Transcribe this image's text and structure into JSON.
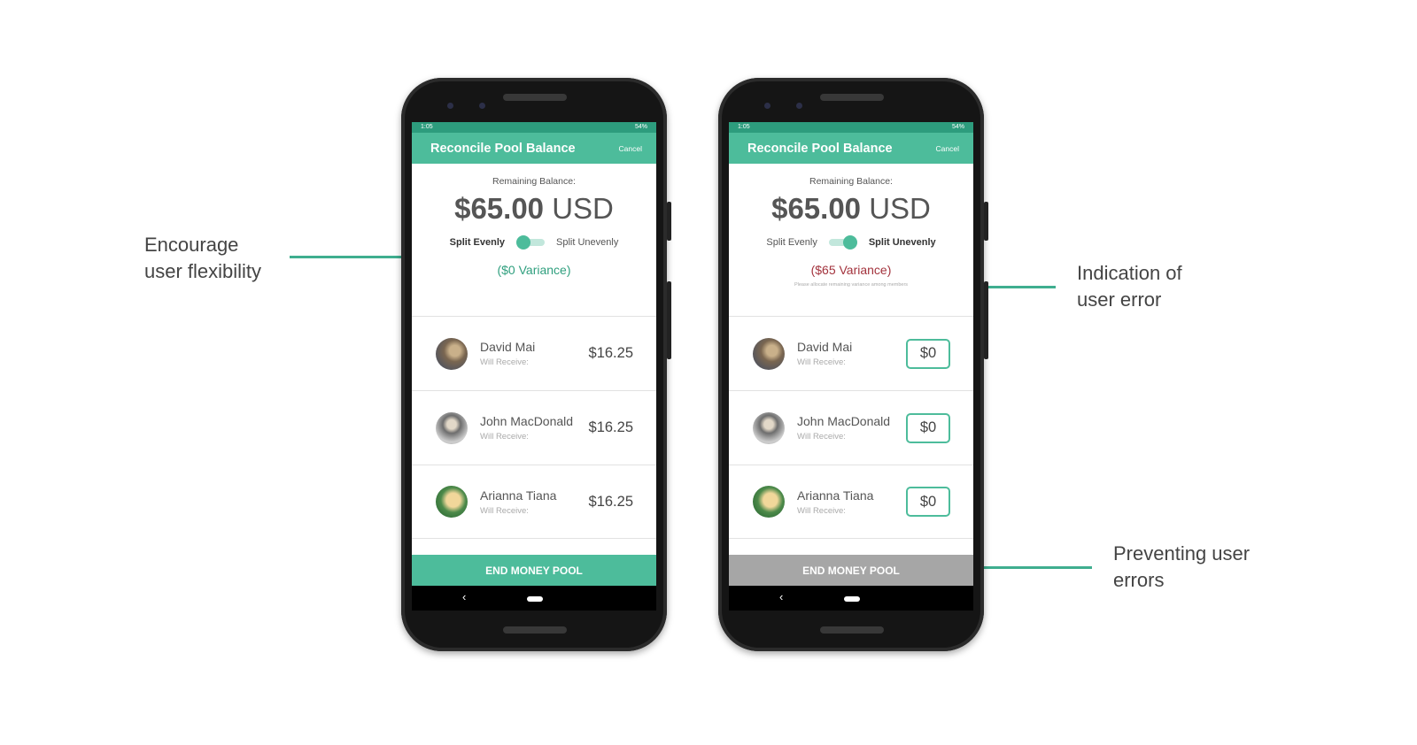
{
  "annotations": {
    "left": [
      "Encourage",
      "user flexibility"
    ],
    "right_top": [
      "Indication of",
      "user error"
    ],
    "right_bottom": [
      "Preventing user",
      "errors"
    ]
  },
  "colors": {
    "accent": "#4dbc9b",
    "status_bar": "#2d9c7d",
    "variance_ok": "#2f9f7e",
    "variance_error": "#a3333d",
    "disabled": "#a6a6a6"
  },
  "screens": [
    {
      "status": {
        "time": "1:05",
        "battery": "54%"
      },
      "appbar": {
        "title": "Reconcile Pool Balance",
        "cancel": "Cancel"
      },
      "balance": {
        "label": "Remaining Balance:",
        "amount": "$65.00",
        "currency": "USD"
      },
      "split": {
        "left": "Split Evenly",
        "right": "Split Unevenly",
        "selected": "Split Evenly"
      },
      "variance": "($0 Variance)",
      "members": [
        {
          "name": "David Mai",
          "sub": "Will Receive:",
          "amount": "$16.25"
        },
        {
          "name": "John MacDonald",
          "sub": "Will Receive:",
          "amount": "$16.25"
        },
        {
          "name": "Arianna Tiana",
          "sub": "Will Receive:",
          "amount": "$16.25"
        }
      ],
      "end_button": "END MONEY POOL",
      "nav": {
        "back_icon": "‹"
      }
    },
    {
      "status": {
        "time": "1:05",
        "battery": "54%"
      },
      "appbar": {
        "title": "Reconcile Pool Balance",
        "cancel": "Cancel"
      },
      "balance": {
        "label": "Remaining Balance:",
        "amount": "$65.00",
        "currency": "USD"
      },
      "split": {
        "left": "Split Evenly",
        "right": "Split Unevenly",
        "selected": "Split Unevenly"
      },
      "variance": "($65 Variance)",
      "hint": "Please allocate remaining variance among members",
      "members": [
        {
          "name": "David Mai",
          "sub": "Will Receive:",
          "amount": "$0"
        },
        {
          "name": "John MacDonald",
          "sub": "Will Receive:",
          "amount": "$0"
        },
        {
          "name": "Arianna Tiana",
          "sub": "Will Receive:",
          "amount": "$0"
        }
      ],
      "end_button": "END MONEY POOL",
      "nav": {
        "back_icon": "‹"
      }
    }
  ]
}
